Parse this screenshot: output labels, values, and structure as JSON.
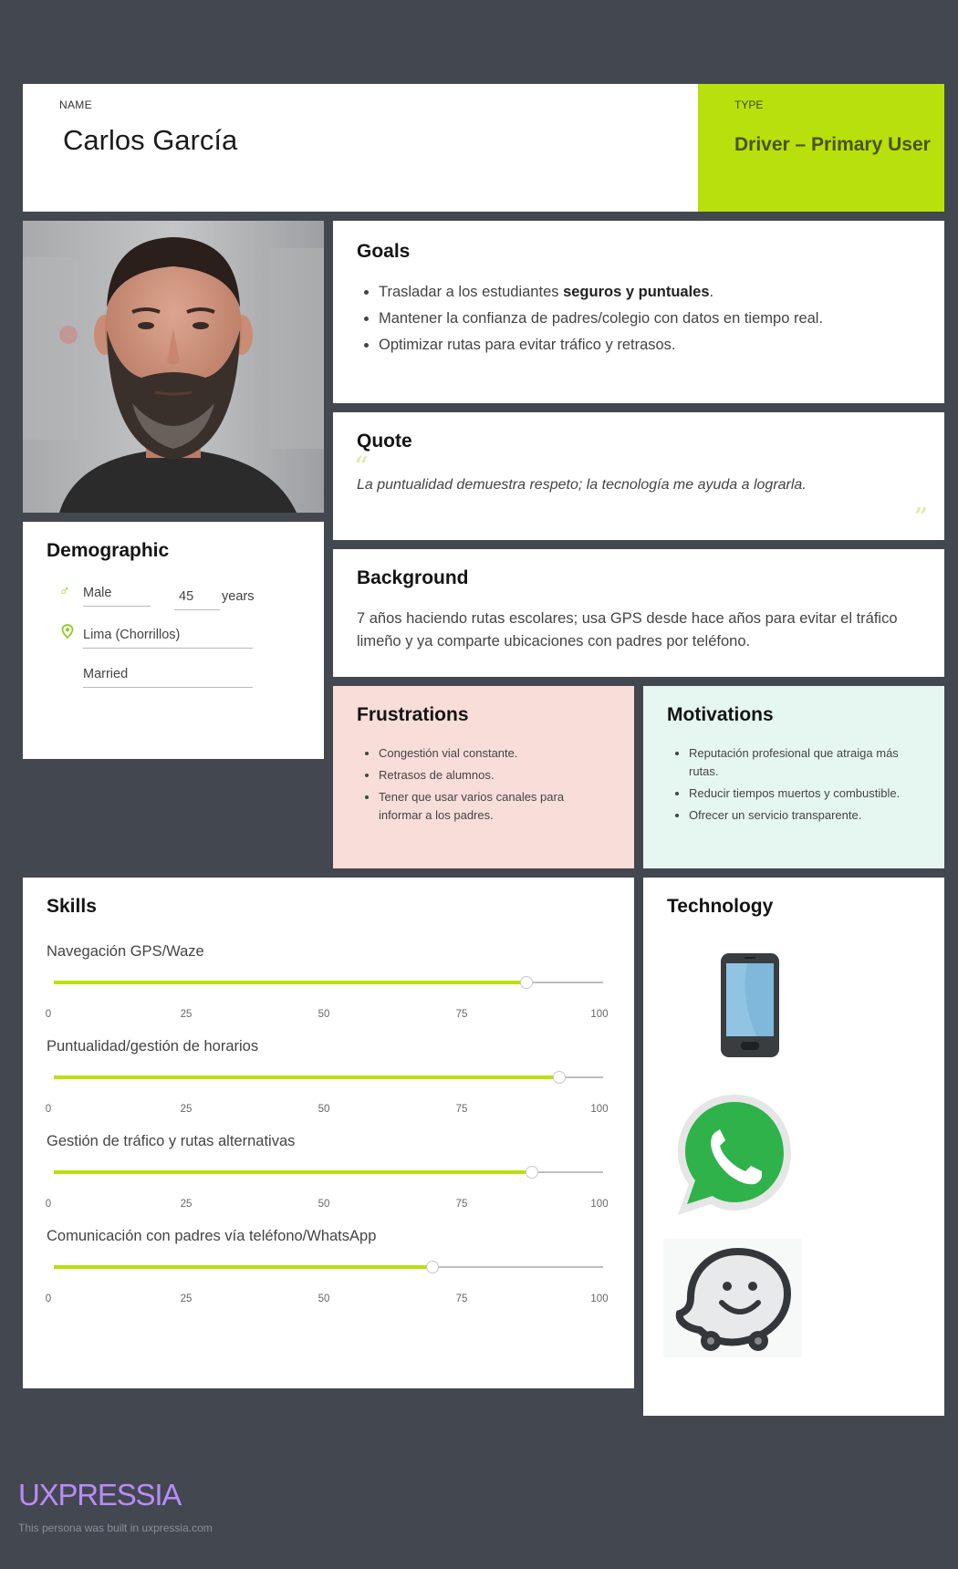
{
  "header": {
    "name_label": "NAME",
    "name": "Carlos García",
    "type_label": "TYPE",
    "type": "Driver – Primary User",
    "type_color": "#b8e00c"
  },
  "photo": {
    "icon": "persona-photo"
  },
  "goals": {
    "title": "Goals",
    "items": [
      {
        "pre": "Trasladar a los estudiantes ",
        "bold": "seguros y puntuales",
        "post": "."
      },
      {
        "pre": "Mantener la confianza de padres/colegio con datos en tiempo real.",
        "bold": "",
        "post": ""
      },
      {
        "pre": "Optimizar rutas para evitar tráfico y retrasos.",
        "bold": "",
        "post": ""
      }
    ]
  },
  "quote": {
    "title": "Quote",
    "text": "La puntualidad demuestra respeto; la tecnología me ayuda a lograrla.",
    "open_mark": "“",
    "close_mark": "”"
  },
  "background": {
    "title": "Background",
    "text": "7 años haciendo rutas escolares; usa GPS desde hace años para evitar el tráfico limeño y ya comparte ubicaciones con padres por teléfono."
  },
  "demographic": {
    "title": "Demographic",
    "gender": "Male",
    "age": "45",
    "age_unit": "years",
    "location": "Lima (Chorrillos)",
    "status": "Married"
  },
  "frustrations": {
    "title": "Frustrations",
    "items": [
      "Congestión vial constante.",
      "Retrasos de alumnos.",
      "Tener que usar varios canales para informar a los padres."
    ]
  },
  "motivations": {
    "title": "Motivations",
    "items": [
      "Reputación profesional que atraiga más rutas.",
      "Reducir tiempos muertos y combustible.",
      "Ofrecer un servicio transparente."
    ]
  },
  "skills": {
    "title": "Skills",
    "scale": [
      "0",
      "25",
      "50",
      "75",
      "100"
    ],
    "items": [
      {
        "label": "Navegación GPS/Waze",
        "value": 86
      },
      {
        "label": "Puntualidad/gestión de horarios",
        "value": 92
      },
      {
        "label": "Gestión de tráfico y rutas alternativas",
        "value": 87
      },
      {
        "label": "Comunicación con padres vía teléfono/WhatsApp",
        "value": 69
      }
    ]
  },
  "technology": {
    "title": "Technology",
    "items": [
      "smartphone-icon",
      "whatsapp-icon",
      "waze-icon"
    ]
  },
  "footer": {
    "logo": "UXPRESSIA",
    "credit": "This persona was built in uxpressia.com"
  }
}
